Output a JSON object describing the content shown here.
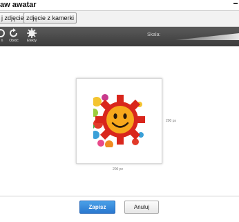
{
  "window": {
    "title": "aw awatar"
  },
  "buttons": {
    "upload": "j zdjęcie",
    "camera": "zdjęcie z kamerki"
  },
  "toolbar": {
    "partial_label": "n",
    "rotate_label": "Obróć",
    "effects_label": "Efekty",
    "scale_label": "Skala:"
  },
  "image": {
    "width_label": "200 px",
    "height_label": "200 px"
  },
  "footer": {
    "save": "Zapisz",
    "cancel": "Anuluj"
  },
  "colors": {
    "accent": "#2a78cf",
    "toolbar": "#474747"
  }
}
